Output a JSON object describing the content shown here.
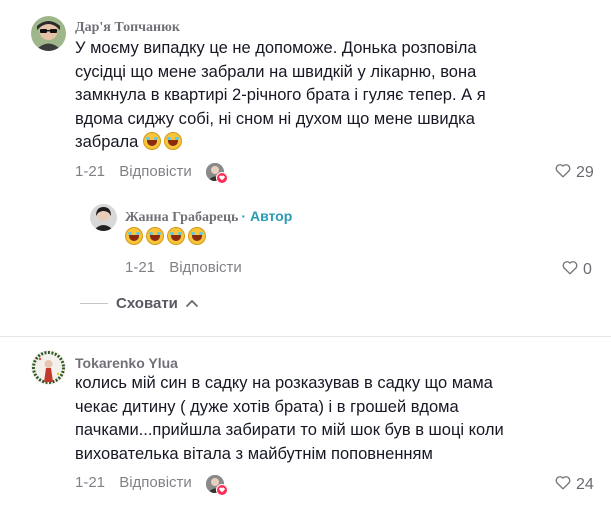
{
  "comments": [
    {
      "username": "Дар'я Топчанюк",
      "lines": [
        "У моєму випадку це не допоможе. Донька розповіла",
        "сусідці що мене забрали на швидкій у лікарню, вона",
        "замкнула в квартирі 2-річного брата і гуляє тепер. А я",
        "вдома сиджу собі, ні сном ні духом що мене швидка",
        "забрала"
      ],
      "emojis": [
        "rolling-on-floor-laughing",
        "rolling-on-floor-laughing"
      ],
      "date": "1-21",
      "reply_label": "Відповісти",
      "likes": "29"
    },
    {
      "username": "Жанна Грабарець",
      "badge": "· Автор",
      "emojis": [
        "joy",
        "rolling-on-floor-laughing",
        "rolling-on-floor-laughing",
        "rolling-on-floor-laughing"
      ],
      "date": "1-21",
      "reply_label": "Відповісти",
      "likes": "0"
    },
    {
      "username": "Tokarenko Ylua",
      "lines": [
        "колись мій син в садку на розказував в садку що мама",
        "чекає дитину ( дуже хотів брата) і в грошей вдома",
        "пачками...прийшла забирати то мій шок був в шоці коли",
        "вихователька вітала з майбутнім поповненням"
      ],
      "date": "1-21",
      "reply_label": "Відповісти",
      "likes": "24"
    }
  ],
  "hide_replies_label": "Сховати",
  "icons": {
    "heart": "heart-outline-icon",
    "chevron": "chevron-up-icon"
  },
  "colors": {
    "author_badge": "#2a9bb5",
    "liker_badge": "#fe2c55"
  }
}
